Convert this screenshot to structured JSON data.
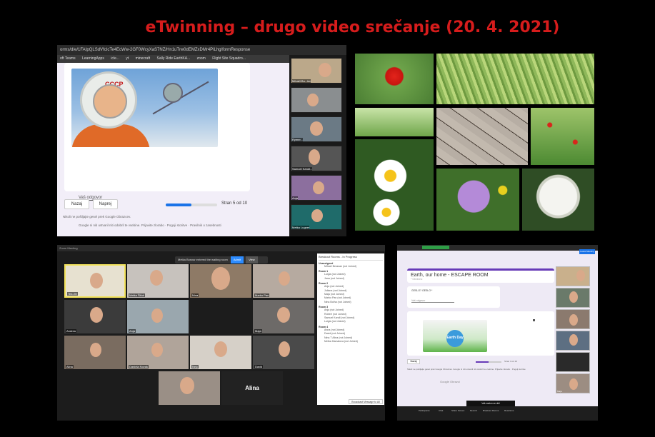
{
  "title": "eTwinning – drugo video srečanje (20. 4. 2021)",
  "top_left": {
    "url_bar": "orms/d/e/1FAIpQLSdVfcIcTe4EcWw-2GF0WcyXaS7NZ/Hn1uTrw0dEMZxDMr4PiLhg/formResponse",
    "bookmarks": [
      "oft Teams",
      "LearningApps",
      "icle...",
      "yt",
      "minecraft",
      "Sally Ride EarthKA...",
      "zoom",
      "Flight Site Squadro..."
    ],
    "helmet_text": "CCCP",
    "answer_placeholder": "Vaš odgovor",
    "back_button": "Nazaj",
    "next_button": "Naprej",
    "progress_text": "Stran 5 od 10",
    "progress_fraction": 0.5,
    "note_1": "Nikoli ne pošiljajte gesel prek Google Obrazcev.",
    "note_2": "Google ni niti ustvaril niti odobril te vsebine. Prijavite zlorabo · Pogoji storitve · Pravilnik o zasebnosti",
    "video_names": [
      "Mihaël Bu...inn",
      "",
      "Rymer...",
      "Samuel Kandl...",
      "Anja",
      "Metka Lugner"
    ]
  },
  "bottom_left": {
    "topbar": "Zoom Meeting",
    "notif_text": "Metka Bosnar entered the waiting room",
    "admit": "Admit",
    "view": "View",
    "tiles": [
      {
        "name": "Tea Jer"
      },
      {
        "name": "Metka Šifuš"
      },
      {
        "name": "Nina"
      },
      {
        "name": "Marko Pan"
      },
      {
        "name": ""
      },
      {
        "name": "Andrea"
      },
      {
        "name": "Anja"
      },
      {
        "name": ""
      },
      {
        "name": "Maja"
      },
      {
        "name": "Alina"
      },
      {
        "name": "Daniela Novak"
      },
      {
        "name": "Nejc"
      },
      {
        "name": "David"
      },
      {
        "name": ""
      }
    ],
    "center_name": "Alina",
    "rooms_header": "Breakout Rooms - In Progress",
    "rooms": [
      {
        "name": "Unassigned",
        "people": [
          "Mihael Berasan (not Joined)"
        ]
      },
      {
        "name": "Room 1",
        "people": [
          "Luigia (not Joined)",
          "Jana (not Joined)"
        ]
      },
      {
        "name": "Room 2",
        "people": [
          "Anja (not Joined)",
          "Juliana (not Joined)",
          "Maja (not Joined)",
          "Marko Pan (not Joined)",
          "Nina Bolha (not Joined)"
        ]
      },
      {
        "name": "Room 3",
        "people": [
          "Anja (not Joined)",
          "Robert (not Joined)",
          "Samuel Kandl (not Joined)",
          "Luigia (not Joined)"
        ]
      },
      {
        "name": "Room 4",
        "people": [
          "Anna (not Joined)",
          "David (not Joined)",
          "Nina T Alina (not Joined)",
          "Metka Hamalova (not Joined)"
        ]
      }
    ],
    "broadcast": "Broadcast Message to All"
  },
  "bottom_right": {
    "form_title": "Earth, our home - ESCAPE ROOM",
    "form_subtitle": "* Obvezno",
    "question": "GESLO? GESLO *",
    "answer": "Vaš odgovor",
    "earth_text": "Earth Day",
    "back_button": "Nazaj",
    "progress_text": "Stran 3 od 10",
    "footer": "Nikoli ne pošiljajte gesel prek Google Obrazcev. Google ni niti ustvaril niti odobril te vsebine. Prijavite zlorabo · Pogoji storitve",
    "google_forms": "Google Obrazci",
    "banner": "Vaš zaslon se deli",
    "leave": "Leave Meeting",
    "controls": [
      "Participants",
      "Chat",
      "Share Screen",
      "Record",
      "Breakout Rooms",
      "Reactions"
    ],
    "video_names": [
      "",
      "",
      "",
      "",
      "",
      "Maja",
      ""
    ]
  }
}
